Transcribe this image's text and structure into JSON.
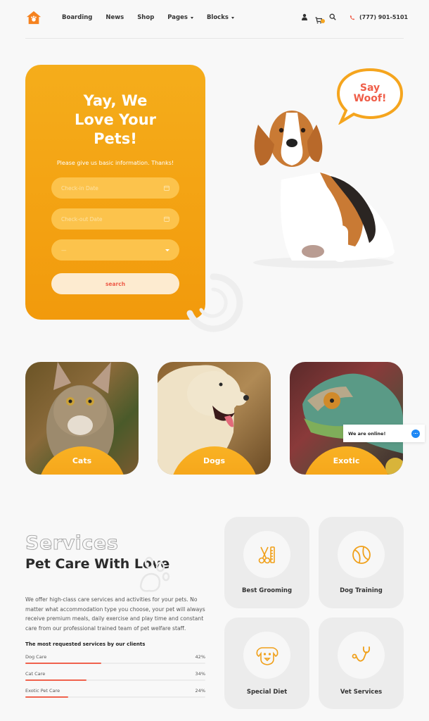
{
  "header": {
    "logo": "paw-house-logo",
    "nav": [
      {
        "label": "Boarding",
        "has_dropdown": false
      },
      {
        "label": "News",
        "has_dropdown": false
      },
      {
        "label": "Shop",
        "has_dropdown": false
      },
      {
        "label": "Pages",
        "has_dropdown": true
      },
      {
        "label": "Blocks",
        "has_dropdown": true
      }
    ],
    "icons": [
      "user-icon",
      "cart-icon",
      "search-icon"
    ],
    "cart_count": "0",
    "phone": "(777) 901-5101"
  },
  "hero": {
    "title_lines": [
      "Yay, We",
      "Love Your",
      "Pets!"
    ],
    "subtitle": "Please give us basic information. Thanks!",
    "checkin_placeholder": "Check-in Date",
    "checkout_placeholder": "Check-out Date",
    "select_value": "—",
    "search_label": "search",
    "bubble_lines": [
      "Say",
      "Woof!"
    ]
  },
  "categories": [
    {
      "label": "Cats"
    },
    {
      "label": "Dogs"
    },
    {
      "label": "Exotic"
    }
  ],
  "chat": {
    "label": "We are online!"
  },
  "services": {
    "outline_title": "Services",
    "title": "Pet Care With Love",
    "description": "We offer high-class care services and activities for your pets. No matter what accommodation type you choose, your pet will always receive premium meals, daily exercise and play time and constant care from our professional trained team of pet welfare staff.",
    "bars_title": "The most requested services by our clients",
    "bars": [
      {
        "label": "Dog Care",
        "percent": 42,
        "percent_label": "42%"
      },
      {
        "label": "Cat Care",
        "percent": 34,
        "percent_label": "34%"
      },
      {
        "label": "Exotic Pet Care",
        "percent": 24,
        "percent_label": "24%"
      }
    ],
    "cards": [
      {
        "label": "Best Grooming",
        "icon": "grooming-icon"
      },
      {
        "label": "Dog Training",
        "icon": "ball-icon"
      },
      {
        "label": "Special Diet",
        "icon": "dog-face-icon"
      },
      {
        "label": "Vet Services",
        "icon": "stethoscope-icon"
      }
    ]
  },
  "colors": {
    "accent": "#f5a623",
    "accent_dark": "#f29a0c",
    "coral": "#ef5d48",
    "chat_blue": "#1e88f5"
  }
}
